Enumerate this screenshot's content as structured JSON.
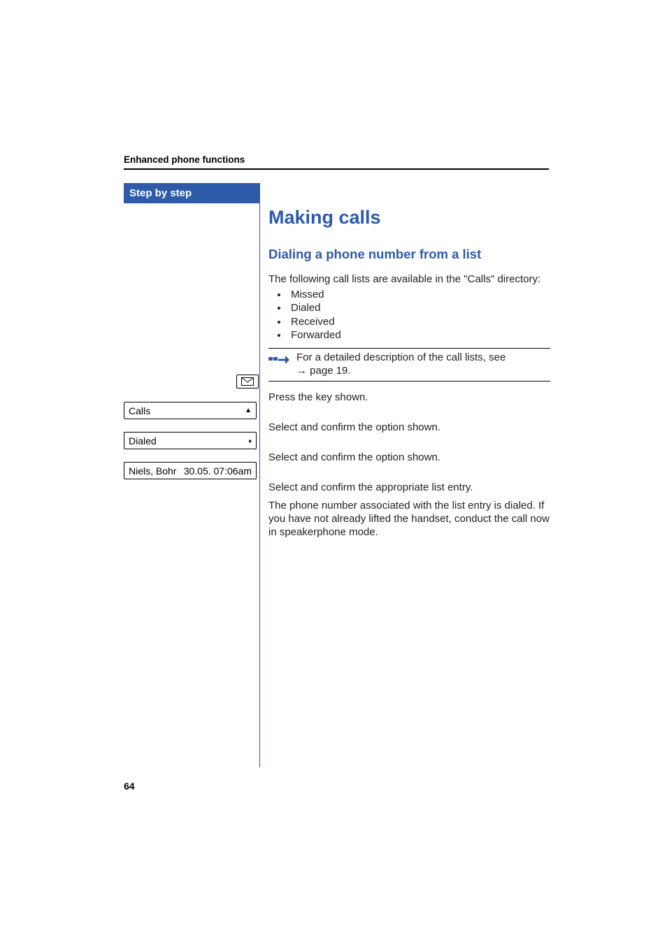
{
  "runningHead": "Enhanced phone functions",
  "stepBanner": "Step by step",
  "h1": "Making calls",
  "h2": "Dialing a phone number from a list",
  "introText": "The following call lists are available in the \"Calls\" directory:",
  "bullets": [
    "Missed",
    "Dialed",
    "Received",
    "Forwarded"
  ],
  "note": {
    "line1": "For a detailed description of the call lists, see",
    "arrow": "→",
    "pageRef": "page 19."
  },
  "steps": {
    "pressKey": "Press the key shown.",
    "selectCalls": "Select and confirm the option shown.",
    "selectDialed": "Select and confirm the option shown.",
    "selectEntry": "Select and confirm the appropriate list entry.",
    "dialResult": "The phone number associated with the list entry is dialed. If you have not already lifted the handset, conduct the call now in speakerphone mode."
  },
  "displays": {
    "calls": {
      "label": "Calls",
      "symbol": "▲"
    },
    "dialed": {
      "label": "Dialed",
      "symbol": "♦"
    },
    "entry": {
      "left": "Niels, Bohr",
      "right": "30.05. 07:06am"
    }
  },
  "pageNumber": "64"
}
